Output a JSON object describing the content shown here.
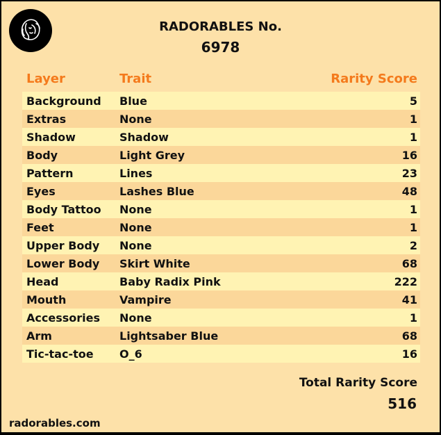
{
  "header": {
    "title": "RADORABLES No.",
    "number": "6978",
    "logo_icon": "radorables-face-logo-icon"
  },
  "columns": {
    "layer": "Layer",
    "trait": "Trait",
    "score": "Rarity Score"
  },
  "rows": [
    {
      "layer": "Background",
      "trait": "Blue",
      "score": "5"
    },
    {
      "layer": "Extras",
      "trait": "None",
      "score": "1"
    },
    {
      "layer": "Shadow",
      "trait": "Shadow",
      "score": "1"
    },
    {
      "layer": "Body",
      "trait": "Light Grey",
      "score": "16"
    },
    {
      "layer": "Pattern",
      "trait": "Lines",
      "score": "23"
    },
    {
      "layer": "Eyes",
      "trait": "Lashes Blue",
      "score": "48"
    },
    {
      "layer": "Body Tattoo",
      "trait": "None",
      "score": "1"
    },
    {
      "layer": "Feet",
      "trait": "None",
      "score": "1"
    },
    {
      "layer": "Upper Body",
      "trait": "None",
      "score": "2"
    },
    {
      "layer": "Lower Body",
      "trait": "Skirt White",
      "score": "68"
    },
    {
      "layer": "Head",
      "trait": "Baby Radix Pink",
      "score": "222"
    },
    {
      "layer": "Mouth",
      "trait": "Vampire",
      "score": "41"
    },
    {
      "layer": "Accessories",
      "trait": "None",
      "score": "1"
    },
    {
      "layer": "Arm",
      "trait": "Lightsaber Blue",
      "score": "68"
    },
    {
      "layer": "Tic-tac-toe",
      "trait": "O_6",
      "score": "16"
    }
  ],
  "total": {
    "label": "Total Rarity Score",
    "value": "516"
  },
  "footer": {
    "site": "radorables.com"
  },
  "colors": {
    "background": "#fde1a9",
    "header_accent": "#f47a1c",
    "row_light": "#fff3b3",
    "row_dark": "#fbd79a",
    "border": "#000000"
  }
}
